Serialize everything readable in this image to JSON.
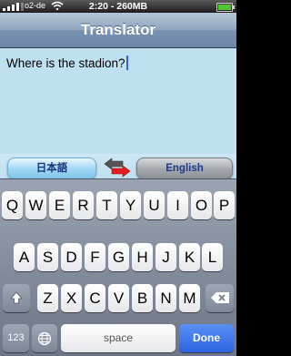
{
  "status_bar": {
    "carrier": "o2-de",
    "time": "2:20 - 260MB"
  },
  "nav": {
    "title": "Translator"
  },
  "input": {
    "text": "Where is the stadion?"
  },
  "languages": {
    "source": "日本語",
    "target": "English"
  },
  "colors": {
    "accent_blue": "#2b64e3",
    "text_area_bg": "#bfe0f1",
    "swap_arrow_red": "#e21d1d",
    "swap_arrow_gray": "#555555"
  },
  "keyboard": {
    "row1": [
      "Q",
      "W",
      "E",
      "R",
      "T",
      "Y",
      "U",
      "I",
      "O",
      "P"
    ],
    "row2": [
      "A",
      "S",
      "D",
      "F",
      "G",
      "H",
      "J",
      "K",
      "L"
    ],
    "row3": [
      "Z",
      "X",
      "C",
      "V",
      "B",
      "N",
      "M"
    ],
    "mode_label": "123",
    "space_label": "space",
    "done_label": "Done"
  }
}
